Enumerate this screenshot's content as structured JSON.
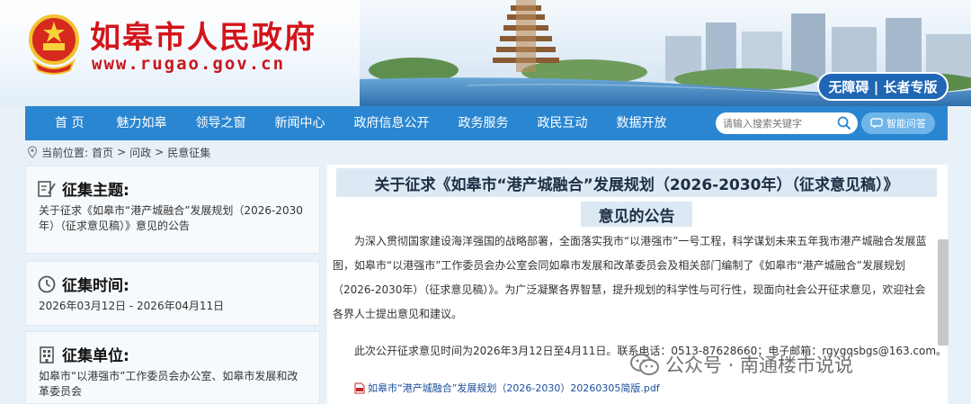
{
  "header": {
    "site_title": "如皋市人民政府",
    "site_url": "www.rugao.gov.cn",
    "accessibility_label": "无障碍 | 长者专版"
  },
  "nav": {
    "items": [
      "首 页",
      "魅力如皋",
      "领导之窗",
      "新闻中心",
      "政府信息公开",
      "政务服务",
      "政民互动",
      "数据开放"
    ],
    "search_placeholder": "请输入搜索关键字",
    "qa_label": "智能问答"
  },
  "breadcrumb": {
    "prefix": "当前位置:",
    "path": [
      "首页",
      "问政",
      "民意征集"
    ],
    "separator": ">"
  },
  "sidebar": {
    "topic": {
      "heading": "征集主题:",
      "text": "关于征求《如皋市“港产城融合”发展规划（2026-2030年）（征求意见稿）》意见的公告"
    },
    "time": {
      "heading": "征集时间:",
      "text": "2026年03月12日 - 2026年04月11日"
    },
    "unit": {
      "heading": "征集单位:",
      "text": "如皋市“以港强市”工作委员会办公室、如皋市发展和改革委员会"
    }
  },
  "article": {
    "title": "关于征求《如皋市“港产城融合”发展规划（2026-2030年）（征求意见稿）》",
    "subtitle": "意见的公告",
    "para1": "为深入贯彻国家建设海洋强国的战略部署，全面落实我市“以港强市”一号工程，科学谋划未来五年我市港产城融合发展蓝图，如皋市“以港强市”工作委员会办公室会同如皋市发展和改革委员会及相关部门编制了《如皋市“港产城融合”发展规划（2026-2030年）（征求意见稿）》。为广泛凝聚各界智慧，提升规划的科学性与可行性，现面向社会公开征求意见，欢迎社会各界人士提出意见和建议。",
    "para2": "此次公开征求意见时间为2026年3月12日至4月11日。联系电话：0513-87628660；电子邮箱：rgygqsbgs@163.com。",
    "attachment": "如皋市“港产城融合”发展规划（2026-2030）20260305简版.pdf"
  },
  "watermark": {
    "text": "公众号 · 南通楼市说说"
  },
  "colors": {
    "brand_red": "#d3141b",
    "nav_blue": "#2a86d1",
    "title_bg": "#dce9f5"
  }
}
